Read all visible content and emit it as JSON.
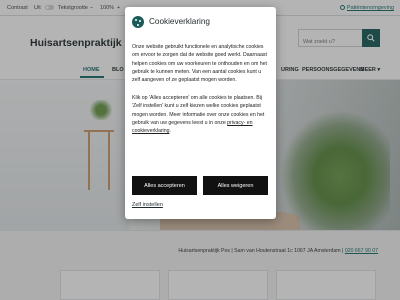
{
  "topbar": {
    "contrast_label": "Contrast",
    "contrast_state": "Uit",
    "fontsize_label": "Tekstgrootte",
    "zoom_minus": "−",
    "zoom_value": "100%",
    "zoom_plus": "+",
    "patient_link": "Patiëntenomgeving"
  },
  "header": {
    "site_title": "Huisartsenpraktijk",
    "search_placeholder": "Wat zoekt u?"
  },
  "nav": {
    "items": [
      "HOME",
      "BLO",
      "URING",
      "PERSOONSGEGEVENS",
      "MEER"
    ],
    "more_chevron": "▾"
  },
  "address": {
    "text": "Huisartsenpraktijk Pos  |  Sam van Houtenstraat 1c 1067 JA  Amsterdam  |",
    "phone": "020 667 90 07"
  },
  "modal": {
    "title": "Cookieverklaring",
    "p1": "Onze website gebruikt functionele en analytische cookies om ervoor te zorgen dat de website goed werkt. Daarnaast helpen cookies om uw voorkeuren te onthouden en om het gebruik te kunnen meten. Van een aantal cookies kunt u zelf aangeven of ze geplaatst mogen worden.",
    "p2_before": "Klik op 'Alles accepteren' om alle cookies te plaatsen. Bij 'Zelf instellen' kunt u zelf kiezen welke cookies geplaatst mogen worden. Meer informatie over onze cookies en het gebruik van uw gegevens leest u in onze ",
    "p2_link": "privacy- en cookieverklaring",
    "p2_after": ".",
    "accept_label": "Alles accepteren",
    "reject_label": "Alles weigeren",
    "own_setting_label": "Zelf instellen"
  },
  "colors": {
    "accent": "#1a6f6c",
    "dark_teal": "#1a5c5a",
    "button_bg": "#111111"
  }
}
